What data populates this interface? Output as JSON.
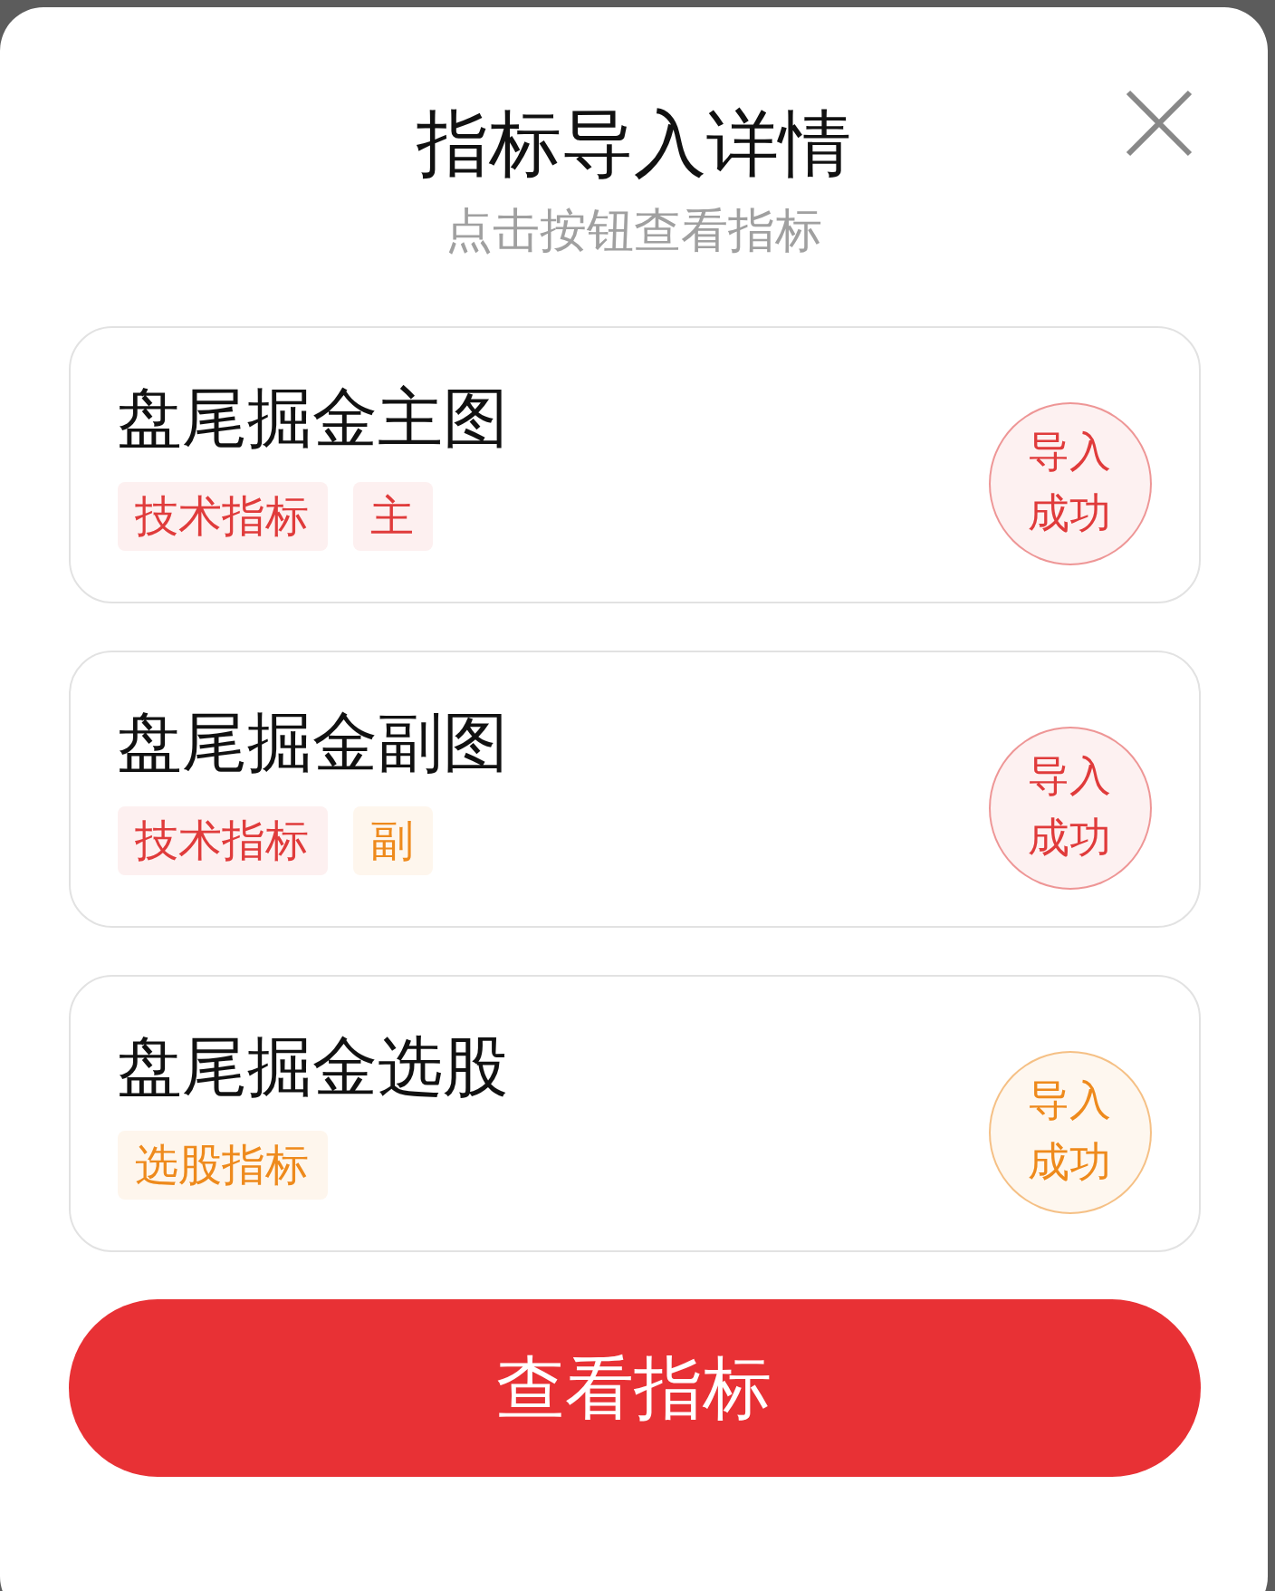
{
  "dialog": {
    "title": "指标导入详情",
    "subtitle": "点击按钮查看指标"
  },
  "indicators": [
    {
      "name": "盘尾掘金主图",
      "tags": [
        {
          "label": "技术指标",
          "color": "#e03b3b"
        },
        {
          "label": "主",
          "color": "#e03b3b"
        }
      ],
      "status": "导入成功",
      "color": "#e03b3b"
    },
    {
      "name": "盘尾掘金副图",
      "tags": [
        {
          "label": "技术指标",
          "color": "#e03b3b"
        },
        {
          "label": "副",
          "color": "#ee8a1c"
        }
      ],
      "status": "导入成功",
      "color": "#e03b3b"
    },
    {
      "name": "盘尾掘金选股",
      "tags": [
        {
          "label": "选股指标",
          "color": "#ee8a1c"
        }
      ],
      "status": "导入成功",
      "color": "#ee8a1c"
    }
  ],
  "primary_button": "查看指标"
}
